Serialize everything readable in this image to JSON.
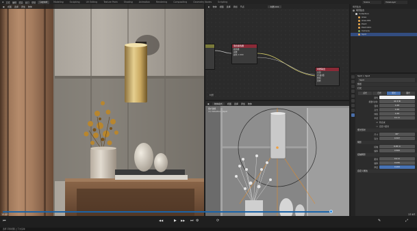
{
  "topbar": {
    "menus": [
      "文件",
      "编辑",
      "渲染",
      "窗口",
      "帮助"
    ],
    "workspaces": [
      {
        "label": "Layout",
        "active": true
      },
      {
        "label": "Modeling",
        "active": false
      },
      {
        "label": "Sculpting",
        "active": false
      },
      {
        "label": "UV Editing",
        "active": false
      },
      {
        "label": "Texture Paint",
        "active": false
      },
      {
        "label": "Shading",
        "active": false
      },
      {
        "label": "Animation",
        "active": false
      },
      {
        "label": "Rendering",
        "active": false
      },
      {
        "label": "Compositing",
        "active": false
      },
      {
        "label": "Geometry Nodes",
        "active": false
      },
      {
        "label": "Scripting",
        "active": false
      }
    ],
    "scene": "Scene",
    "view_layer": "ViewLayer"
  },
  "left_viewport": {
    "header_items": [
      "视图",
      "选择",
      "添加",
      "物体"
    ]
  },
  "node_editor": {
    "header_items": [
      "物体",
      "视图",
      "选择",
      "添加",
      "节点"
    ],
    "material_name": "材质.001",
    "nodes": [
      {
        "title": "混合着色器",
        "rows": [
          "着色器",
          "系数",
          "颜色 1.000"
        ]
      },
      {
        "title": "材质输出",
        "rows": [
          "全部",
          "表(曲)面",
          "体积",
          "置换"
        ]
      }
    ],
    "footer_label": "材质"
  },
  "right_viewport": {
    "header_items": [
      "物体模式",
      "视图",
      "选择",
      "添加",
      "物体"
    ],
    "info_lines": [
      "用户透视",
      "(1) Collection | Spot"
    ]
  },
  "outliner": {
    "title": "场景集合",
    "items": [
      {
        "label": "场景集合",
        "depth": 0,
        "color": "#8a8a8a",
        "selected": false
      },
      {
        "label": "Collection",
        "depth": 1,
        "color": "#d5d5d5",
        "selected": false
      },
      {
        "label": "Area",
        "depth": 2,
        "color": "#e8a84f",
        "selected": false
      },
      {
        "label": "Area.001",
        "depth": 2,
        "color": "#e8a84f",
        "selected": false
      },
      {
        "label": "Point",
        "depth": 2,
        "color": "#e8a84f",
        "selected": false
      },
      {
        "label": "Point.001",
        "depth": 2,
        "color": "#e8a84f",
        "selected": false
      },
      {
        "label": "Camera",
        "depth": 2,
        "color": "#7fa85a",
        "selected": false
      },
      {
        "label": "Spot",
        "depth": 2,
        "color": "#e8a84f",
        "selected": true
      }
    ]
  },
  "properties": {
    "breadcrumb": "Spot  >  Spot",
    "object_name": "Spot",
    "sections": {
      "preview": "预览",
      "light": "灯光"
    },
    "light_types": [
      "点光",
      "日光",
      "聚光",
      "面光"
    ],
    "active_light_type_index": 2,
    "rows": [
      {
        "label": "颜色",
        "value": "",
        "blue": false
      },
      {
        "label": "能量(功率)",
        "value": "41.5 W",
        "blue": false
      },
      {
        "label": "漫射",
        "value": "1.00",
        "blue": false
      },
      {
        "label": "高光",
        "value": "1.00",
        "blue": false
      },
      {
        "label": "体积",
        "value": "1.00",
        "blue": false
      },
      {
        "label": "半径",
        "value": "0.1 m",
        "blue": false
      }
    ],
    "checkbox_rows": [
      "软衰减",
      "自定义距离"
    ],
    "spot_section": "聚光形状",
    "spot_rows": [
      {
        "label": "尺寸",
        "value": "60°",
        "blue": false
      },
      {
        "label": "混合",
        "value": "0.327",
        "blue": false
      }
    ],
    "shadow_section": "阴影",
    "shadow_rows": [
      {
        "label": "接触",
        "value": "0.05 m",
        "blue": false
      },
      {
        "label": "偏移",
        "value": "0.500",
        "blue": false
      }
    ],
    "contact_section": "接触阴影",
    "contact_rows": [
      {
        "label": "距离",
        "value": "0.2 m",
        "blue": false
      },
      {
        "label": "偏移",
        "value": "0.030",
        "blue": false
      },
      {
        "label": "厚度",
        "value": "0.200",
        "blue": true
      }
    ],
    "custom_props": "自定义属性"
  },
  "timeline": {
    "time_current": "15:07",
    "time_total": "17:07",
    "progress": 0.8,
    "transport": {
      "play": "▶",
      "prev": "⏮",
      "next": "⏭",
      "back": "◀◀",
      "fwd": "▶▶"
    }
  },
  "status_bar": {
    "text": "选择   平移视图   上下文菜单"
  },
  "colors": {
    "accent_blue": "#4772b3",
    "timeline_blue": "#1a63a8",
    "light_orange": "#e8a84f"
  }
}
